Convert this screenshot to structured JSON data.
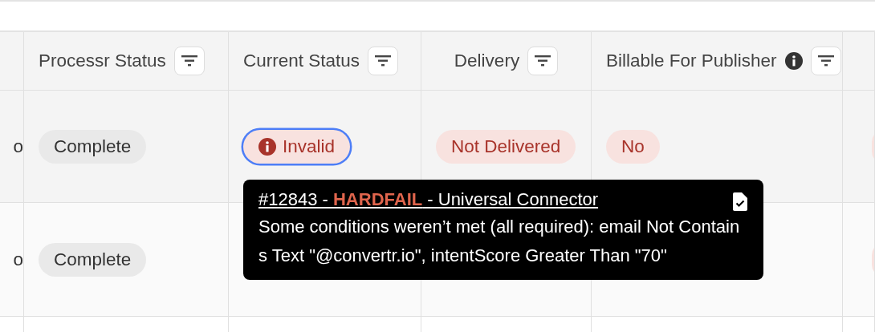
{
  "table": {
    "columns": [
      {
        "label": "Processr Status",
        "filter": true
      },
      {
        "label": "Current Status",
        "filter": true
      },
      {
        "label": "Delivery",
        "filter": true
      },
      {
        "label": "Billable For Publisher",
        "filter": true,
        "info": true
      }
    ],
    "rows": [
      {
        "column_0": "o",
        "cells": [
          {
            "kind": "neutral",
            "text": "Complete"
          },
          {
            "kind": "danger",
            "text": "Invalid",
            "icon": true,
            "focused": true
          },
          {
            "kind": "danger",
            "text": "Not Delivered"
          },
          {
            "kind": "danger",
            "text": "No"
          }
        ]
      },
      {
        "column_0": "o",
        "cells": [
          {
            "kind": "neutral",
            "text": "Complete"
          },
          {
            "kind": "empty"
          },
          {
            "kind": "empty"
          },
          {
            "kind": "empty"
          }
        ]
      }
    ]
  },
  "tooltip": {
    "title": "#12843 - **HARDFAIL** - Universal Connector",
    "message": "Some conditions weren’t met (all required): email Not Contains Text \"@convertr.io\", intentScore Greater Than \"70\""
  }
}
